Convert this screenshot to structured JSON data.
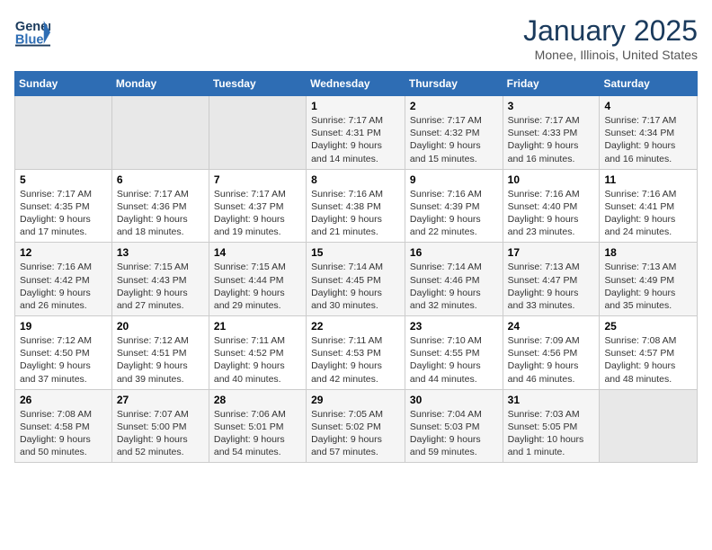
{
  "header": {
    "logo_line1": "General",
    "logo_line2": "Blue",
    "title": "January 2025",
    "subtitle": "Monee, Illinois, United States"
  },
  "days_of_week": [
    "Sunday",
    "Monday",
    "Tuesday",
    "Wednesday",
    "Thursday",
    "Friday",
    "Saturday"
  ],
  "weeks": [
    [
      {
        "day": "",
        "empty": true
      },
      {
        "day": "",
        "empty": true
      },
      {
        "day": "",
        "empty": true
      },
      {
        "day": "1",
        "sunrise": "7:17 AM",
        "sunset": "4:31 PM",
        "daylight": "9 hours and 14 minutes."
      },
      {
        "day": "2",
        "sunrise": "7:17 AM",
        "sunset": "4:32 PM",
        "daylight": "9 hours and 15 minutes."
      },
      {
        "day": "3",
        "sunrise": "7:17 AM",
        "sunset": "4:33 PM",
        "daylight": "9 hours and 16 minutes."
      },
      {
        "day": "4",
        "sunrise": "7:17 AM",
        "sunset": "4:34 PM",
        "daylight": "9 hours and 16 minutes."
      }
    ],
    [
      {
        "day": "5",
        "sunrise": "7:17 AM",
        "sunset": "4:35 PM",
        "daylight": "9 hours and 17 minutes."
      },
      {
        "day": "6",
        "sunrise": "7:17 AM",
        "sunset": "4:36 PM",
        "daylight": "9 hours and 18 minutes."
      },
      {
        "day": "7",
        "sunrise": "7:17 AM",
        "sunset": "4:37 PM",
        "daylight": "9 hours and 19 minutes."
      },
      {
        "day": "8",
        "sunrise": "7:16 AM",
        "sunset": "4:38 PM",
        "daylight": "9 hours and 21 minutes."
      },
      {
        "day": "9",
        "sunrise": "7:16 AM",
        "sunset": "4:39 PM",
        "daylight": "9 hours and 22 minutes."
      },
      {
        "day": "10",
        "sunrise": "7:16 AM",
        "sunset": "4:40 PM",
        "daylight": "9 hours and 23 minutes."
      },
      {
        "day": "11",
        "sunrise": "7:16 AM",
        "sunset": "4:41 PM",
        "daylight": "9 hours and 24 minutes."
      }
    ],
    [
      {
        "day": "12",
        "sunrise": "7:16 AM",
        "sunset": "4:42 PM",
        "daylight": "9 hours and 26 minutes."
      },
      {
        "day": "13",
        "sunrise": "7:15 AM",
        "sunset": "4:43 PM",
        "daylight": "9 hours and 27 minutes."
      },
      {
        "day": "14",
        "sunrise": "7:15 AM",
        "sunset": "4:44 PM",
        "daylight": "9 hours and 29 minutes."
      },
      {
        "day": "15",
        "sunrise": "7:14 AM",
        "sunset": "4:45 PM",
        "daylight": "9 hours and 30 minutes."
      },
      {
        "day": "16",
        "sunrise": "7:14 AM",
        "sunset": "4:46 PM",
        "daylight": "9 hours and 32 minutes."
      },
      {
        "day": "17",
        "sunrise": "7:13 AM",
        "sunset": "4:47 PM",
        "daylight": "9 hours and 33 minutes."
      },
      {
        "day": "18",
        "sunrise": "7:13 AM",
        "sunset": "4:49 PM",
        "daylight": "9 hours and 35 minutes."
      }
    ],
    [
      {
        "day": "19",
        "sunrise": "7:12 AM",
        "sunset": "4:50 PM",
        "daylight": "9 hours and 37 minutes."
      },
      {
        "day": "20",
        "sunrise": "7:12 AM",
        "sunset": "4:51 PM",
        "daylight": "9 hours and 39 minutes."
      },
      {
        "day": "21",
        "sunrise": "7:11 AM",
        "sunset": "4:52 PM",
        "daylight": "9 hours and 40 minutes."
      },
      {
        "day": "22",
        "sunrise": "7:11 AM",
        "sunset": "4:53 PM",
        "daylight": "9 hours and 42 minutes."
      },
      {
        "day": "23",
        "sunrise": "7:10 AM",
        "sunset": "4:55 PM",
        "daylight": "9 hours and 44 minutes."
      },
      {
        "day": "24",
        "sunrise": "7:09 AM",
        "sunset": "4:56 PM",
        "daylight": "9 hours and 46 minutes."
      },
      {
        "day": "25",
        "sunrise": "7:08 AM",
        "sunset": "4:57 PM",
        "daylight": "9 hours and 48 minutes."
      }
    ],
    [
      {
        "day": "26",
        "sunrise": "7:08 AM",
        "sunset": "4:58 PM",
        "daylight": "9 hours and 50 minutes."
      },
      {
        "day": "27",
        "sunrise": "7:07 AM",
        "sunset": "5:00 PM",
        "daylight": "9 hours and 52 minutes."
      },
      {
        "day": "28",
        "sunrise": "7:06 AM",
        "sunset": "5:01 PM",
        "daylight": "9 hours and 54 minutes."
      },
      {
        "day": "29",
        "sunrise": "7:05 AM",
        "sunset": "5:02 PM",
        "daylight": "9 hours and 57 minutes."
      },
      {
        "day": "30",
        "sunrise": "7:04 AM",
        "sunset": "5:03 PM",
        "daylight": "9 hours and 59 minutes."
      },
      {
        "day": "31",
        "sunrise": "7:03 AM",
        "sunset": "5:05 PM",
        "daylight": "10 hours and 1 minute."
      },
      {
        "day": "",
        "empty": true
      }
    ]
  ],
  "labels": {
    "sunrise_prefix": "Sunrise: ",
    "sunset_prefix": "Sunset: ",
    "daylight_prefix": "Daylight: "
  }
}
